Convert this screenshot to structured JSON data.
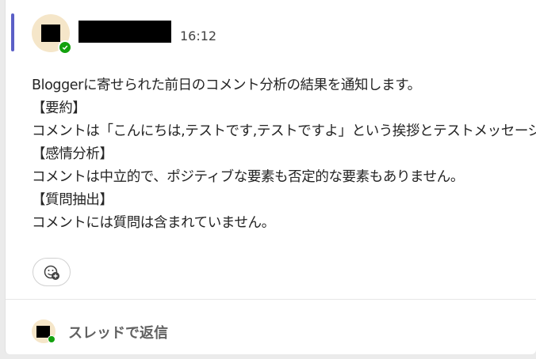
{
  "post": {
    "timestamp": "16:12",
    "message_lines": [
      "Bloggerに寄せられた前日のコメント分析の結果を通知します。",
      "【要約】",
      "コメントは「こんにちは,テストです,テストですよ」という挨拶とテストメッセージです。",
      "【感情分析】",
      "コメントは中立的で、ポジティブな要素も否定的な要素もありません。",
      "【質問抽出】",
      "コメントには質問は含まれていません。"
    ]
  },
  "reply": {
    "label": "スレッドで返信"
  },
  "colors": {
    "accent": "#5b5fc7",
    "presence": "#13a10e",
    "avatar_bg": "#f5e6c9"
  },
  "icons": {
    "reaction": "add-reaction-icon",
    "presence": "available-check-icon"
  }
}
